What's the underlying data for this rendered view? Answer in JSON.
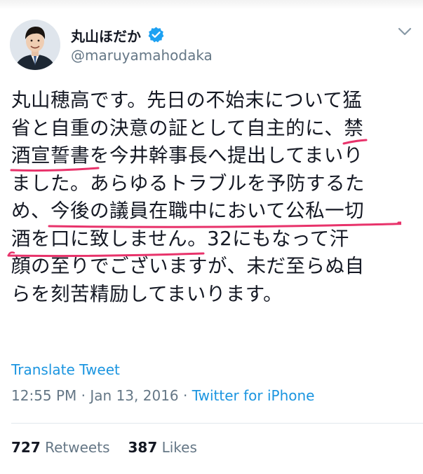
{
  "user": {
    "display_name": "丸山ほだか",
    "handle": "@maruyamahodaka",
    "verified": true
  },
  "tweet": {
    "lines": [
      [
        "丸山穂高です。先日の不始末について猛"
      ],
      [
        "省と自重の決意の証として自主的に、",
        "禁"
      ],
      [
        "酒宣誓書",
        "を今井幹事長へ提出してまいり"
      ],
      [
        "ました。あらゆるトラブルを予防するた"
      ],
      [
        "め、",
        "今後の議員在職中において公私一切"
      ],
      [
        "酒を口に致しません",
        "。32にもなって汗"
      ],
      [
        "顔の至りでございますが、未だ至らぬ自"
      ],
      [
        "らを刻苦精励してまいります。"
      ]
    ],
    "translate_label": "Translate Tweet",
    "time": "12:55 PM",
    "separator": "·",
    "date": "Jan 13, 2016",
    "source": "Twitter for iPhone"
  },
  "stats": {
    "retweets_count": "727",
    "retweets_label": "Retweets",
    "likes_count": "387",
    "likes_label": "Likes"
  },
  "colors": {
    "link": "#1b95e0",
    "secondary_text": "#657786",
    "primary_text": "#141823",
    "highlight_marker": "#e8336b",
    "verified_badge": "#1da1f2"
  },
  "icons": {
    "verified": "verified-badge-icon",
    "menu": "chevron-down-icon"
  }
}
